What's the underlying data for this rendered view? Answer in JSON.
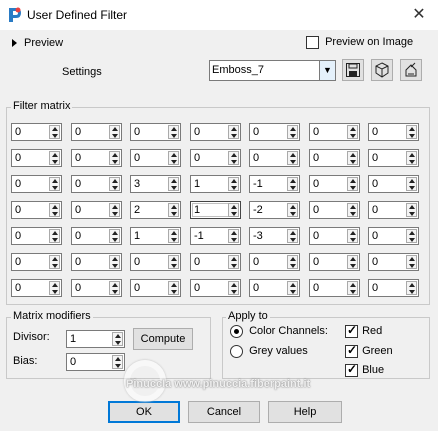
{
  "window": {
    "title": "User Defined Filter",
    "close_glyph": "✕"
  },
  "preview": {
    "label": "Preview",
    "on_image_label": "Preview on Image",
    "on_image_checked": false
  },
  "settings": {
    "label": "Settings",
    "value": "Emboss_7",
    "buttons": [
      "save-icon",
      "reset-icon",
      "load-icon"
    ]
  },
  "filter_matrix": {
    "title": "Filter matrix",
    "rows": [
      [
        "0",
        "0",
        "0",
        "0",
        "0",
        "0",
        "0"
      ],
      [
        "0",
        "0",
        "0",
        "0",
        "0",
        "0",
        "0"
      ],
      [
        "0",
        "0",
        "3",
        "1",
        "-1",
        "0",
        "0"
      ],
      [
        "0",
        "0",
        "2",
        "1",
        "-2",
        "0",
        "0"
      ],
      [
        "0",
        "0",
        "1",
        "-1",
        "-3",
        "0",
        "0"
      ],
      [
        "0",
        "0",
        "0",
        "0",
        "0",
        "0",
        "0"
      ],
      [
        "0",
        "0",
        "0",
        "0",
        "0",
        "0",
        "0"
      ]
    ]
  },
  "matrix_modifiers": {
    "title": "Matrix modifiers",
    "divisor_label": "Divisor:",
    "divisor": "1",
    "compute_label": "Compute",
    "bias_label": "Bias:",
    "bias": "0"
  },
  "apply_to": {
    "title": "Apply to",
    "color_channels_label": "Color Channels:",
    "grey_values_label": "Grey values",
    "mode": "color",
    "channels": [
      {
        "label": "Red",
        "checked": true
      },
      {
        "label": "Green",
        "checked": true
      },
      {
        "label": "Blue",
        "checked": true
      }
    ]
  },
  "buttons": {
    "ok": "OK",
    "cancel": "Cancel",
    "help": "Help"
  },
  "watermark": {
    "text": "PinuccIa   www.pinuccia.fiberpaint.it"
  },
  "colors": {
    "accent": "#0078d7",
    "window_bg": "#f0f0f0"
  }
}
